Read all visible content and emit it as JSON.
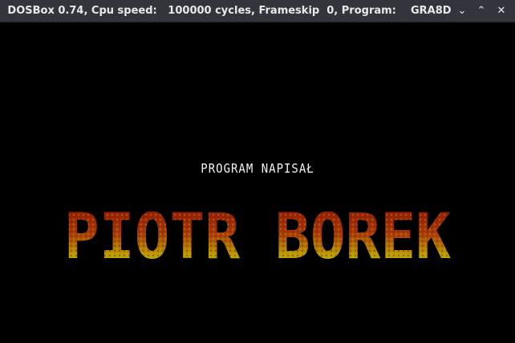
{
  "window": {
    "title": "DOSBox 0.74, Cpu speed:   100000 cycles, Frameskip  0, Program:    GRA8D",
    "minimize_glyph": "⌄",
    "maximize_glyph": "⌃",
    "close_glyph": "✕"
  },
  "screen": {
    "credit_line": "PROGRAM NAPISAŁ",
    "logo_text": "PIOTR BOREK",
    "colors": {
      "background": "#000000",
      "text": "#f2f2f2",
      "logo_top": "#8c1200",
      "logo_mid": "#a83a0a",
      "logo_bottom": "#c8c800"
    }
  }
}
